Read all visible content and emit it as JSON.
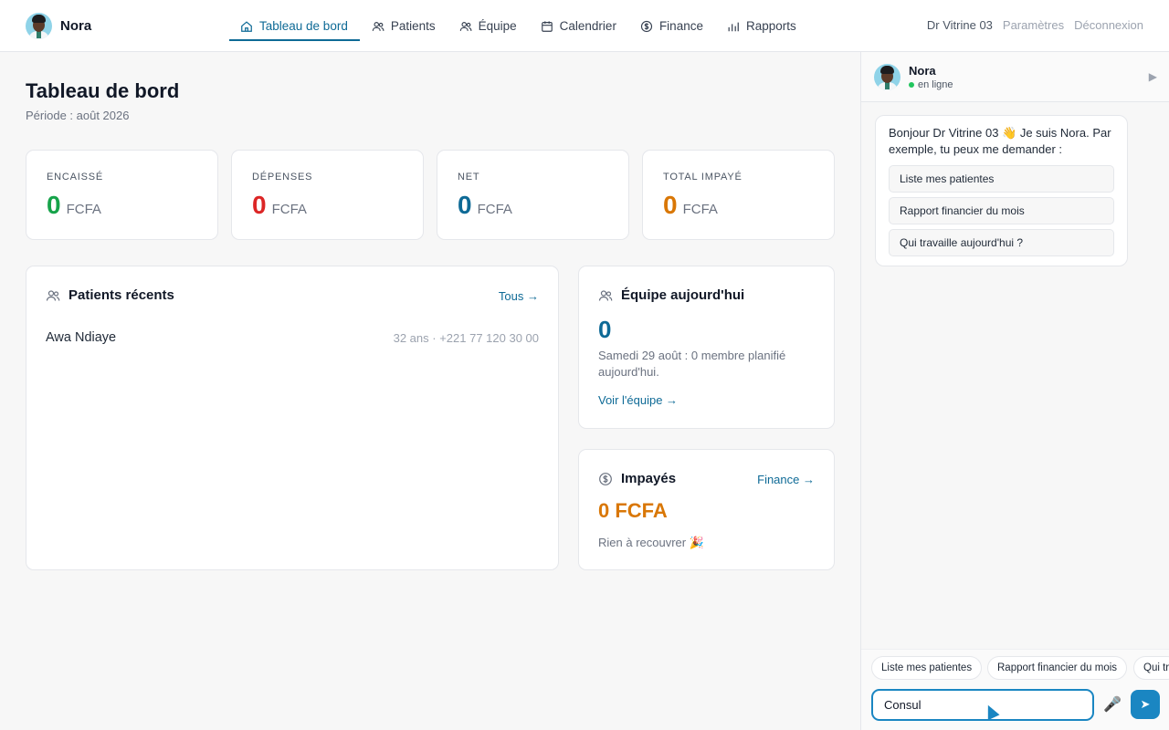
{
  "brand": {
    "name": "Nora"
  },
  "nav": {
    "items": [
      {
        "label": "Tableau de bord",
        "icon": "home-icon",
        "active": true
      },
      {
        "label": "Patients",
        "icon": "users-icon"
      },
      {
        "label": "Équipe",
        "icon": "team-icon"
      },
      {
        "label": "Calendrier",
        "icon": "calendar-icon"
      },
      {
        "label": "Finance",
        "icon": "dollar-circle-icon"
      },
      {
        "label": "Rapports",
        "icon": "bar-chart-icon"
      }
    ]
  },
  "topright": {
    "user": "Dr Vitrine 03",
    "settings": "Paramètres",
    "logout": "Déconnexion"
  },
  "page": {
    "title": "Tableau de bord",
    "subtitle": "Période : août 2026"
  },
  "stats": [
    {
      "label": "ENCAISSÉ",
      "value": "0",
      "unit": "FCFA",
      "color": "#16a34a"
    },
    {
      "label": "DÉPENSES",
      "value": "0",
      "unit": "FCFA",
      "color": "#dc2626"
    },
    {
      "label": "NET",
      "value": "0",
      "unit": "FCFA",
      "color": "#0e6a96"
    },
    {
      "label": "TOTAL IMPAYÉ",
      "value": "0",
      "unit": "FCFA",
      "color": "#d97706"
    }
  ],
  "recent_patients": {
    "title": "Patients récents",
    "link": "Tous →",
    "rows": [
      {
        "name": "Awa Ndiaye",
        "meta": "32 ans · +221 77 120 30 00"
      }
    ]
  },
  "team_today": {
    "title": "Équipe aujourd'hui",
    "count": "0",
    "desc": "Samedi 29 août : 0 membre planifié aujourd'hui.",
    "link": "Voir l'équipe →"
  },
  "unpaid": {
    "title": "Impayés",
    "link": "Finance →",
    "amount": "0 FCFA",
    "note": "Rien à recouvrer 🎉"
  },
  "chat": {
    "name": "Nora",
    "status": "en ligne",
    "collapse": "▶",
    "greeting": "Bonjour Dr Vitrine 03 👋 Je suis Nora. Par exemple, tu peux me demander :",
    "suggestions": [
      "Liste mes patientes",
      "Rapport financier du mois",
      "Qui travaille aujourd'hui ?"
    ],
    "chips": [
      "Liste mes patientes",
      "Rapport financier du mois",
      "Qui tr"
    ],
    "input_value": "Consul",
    "mic": "🎤",
    "send": "➤"
  }
}
